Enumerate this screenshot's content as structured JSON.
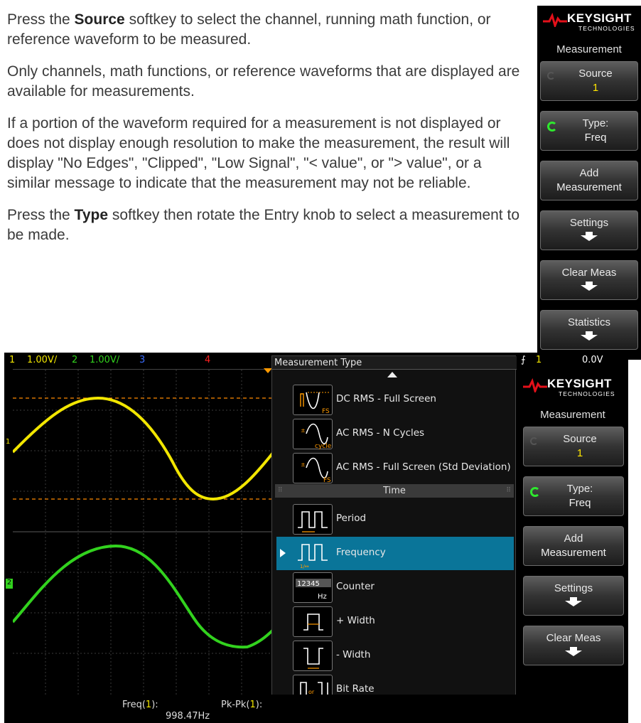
{
  "manual": {
    "p1_a": "Press the ",
    "p1_b": "Source",
    "p1_c": " softkey to select the channel, running math function, or reference waveform to be measured.",
    "p2": "Only channels, math functions, or reference waveforms that are displayed are available for measurements.",
    "p3": "If a portion of the waveform required for a measurement is not displayed or does not display enough resolution to make the measurement, the result will display \"No Edges\", \"Clipped\", \"Low Signal\", \"< value\", or \"> value\", or a similar message to indicate that the measurement may not be reliable.",
    "p4_a": "Press the ",
    "p4_b": "Type",
    "p4_c": " softkey then rotate the Entry knob to select a measurement to be made."
  },
  "menu": {
    "brand": "KEYSIGHT",
    "brand_sub": "TECHNOLOGIES",
    "title": "Measurement",
    "source_label": "Source",
    "source_value": "1",
    "type_label": "Type:",
    "type_value": "Freq",
    "add_l1": "Add",
    "add_l2": "Measurement",
    "settings_label": "Settings",
    "clear_label": "Clear Meas",
    "statistics_label": "Statistics"
  },
  "status": {
    "ch1_num": "1",
    "ch1_scale": "1.00V/",
    "ch2_num": "2",
    "ch2_scale": "1.00V/",
    "ch3_num": "3",
    "ch4_num": "4",
    "trig_ch": "1",
    "trig_level": "0.0V"
  },
  "popup": {
    "title": "Measurement Type",
    "section_time": "Time",
    "items": [
      {
        "label": "DC RMS - Full Screen",
        "icon": "dc-rms-fs-icon"
      },
      {
        "label": "AC RMS - N Cycles",
        "icon": "ac-rms-cycle-icon"
      },
      {
        "label": "AC RMS - Full Screen (Std Deviation)",
        "icon": "ac-rms-fs-icon"
      },
      {
        "label": "Period",
        "icon": "period-icon"
      },
      {
        "label": "Frequency",
        "icon": "frequency-icon"
      },
      {
        "label": "Counter",
        "icon": "counter-icon"
      },
      {
        "label": "+ Width",
        "icon": "plus-width-icon"
      },
      {
        "label": "- Width",
        "icon": "minus-width-icon"
      },
      {
        "label": "Bit Rate",
        "icon": "bit-rate-icon"
      }
    ],
    "counter_digits": "12345",
    "counter_unit": "Hz",
    "icon_fs": "FS",
    "icon_cycle": "cycle",
    "icon_bitrate_or": "or"
  },
  "readout": {
    "freq_label": "Freq(",
    "freq_ch": "1",
    "freq_close": "):",
    "freq_value": "998.47Hz",
    "pkpk_label": "Pk-Pk(",
    "pkpk_ch": "1",
    "pkpk_close": "):"
  },
  "colors": {
    "ch1": "#f2e600",
    "ch2": "#32d21e",
    "ch3": "#3a6cff",
    "ch4": "#ff2020",
    "selection": "#0a7599",
    "marker": "#ff9a00"
  }
}
